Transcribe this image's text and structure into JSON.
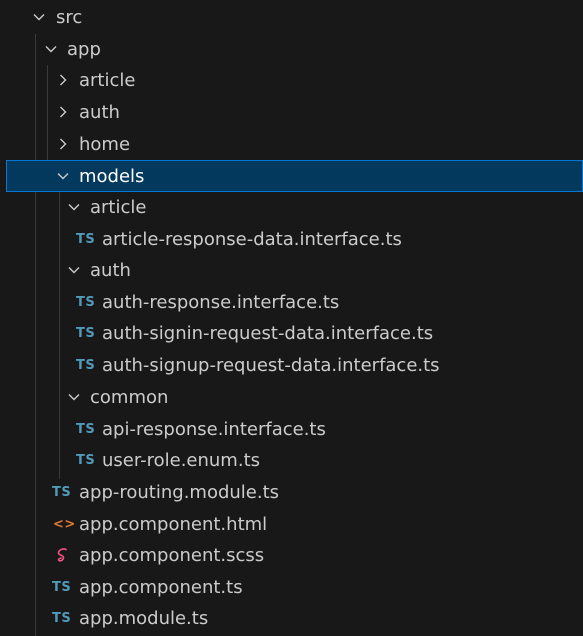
{
  "tree": {
    "src": {
      "label": "src",
      "state": "expanded"
    },
    "app": {
      "label": "app",
      "state": "expanded"
    },
    "article_folder": {
      "label": "article",
      "state": "collapsed"
    },
    "auth_folder": {
      "label": "auth",
      "state": "collapsed"
    },
    "home_folder": {
      "label": "home",
      "state": "collapsed"
    },
    "models_folder": {
      "label": "models",
      "state": "expanded"
    },
    "models_article": {
      "label": "article",
      "state": "expanded"
    },
    "article_response": {
      "label": "article-response-data.interface.ts",
      "icon_text": "TS"
    },
    "models_auth": {
      "label": "auth",
      "state": "expanded"
    },
    "auth_response": {
      "label": "auth-response.interface.ts",
      "icon_text": "TS"
    },
    "auth_signin": {
      "label": "auth-signin-request-data.interface.ts",
      "icon_text": "TS"
    },
    "auth_signup": {
      "label": "auth-signup-request-data.interface.ts",
      "icon_text": "TS"
    },
    "models_common": {
      "label": "common",
      "state": "expanded"
    },
    "api_response": {
      "label": "api-response.interface.ts",
      "icon_text": "TS"
    },
    "user_role": {
      "label": "user-role.enum.ts",
      "icon_text": "TS"
    },
    "app_routing": {
      "label": "app-routing.module.ts",
      "icon_text": "TS"
    },
    "app_component_html": {
      "label": "app.component.html",
      "icon_text": "<>"
    },
    "app_component_scss": {
      "label": "app.component.scss"
    },
    "app_component_ts": {
      "label": "app.component.ts",
      "icon_text": "TS"
    },
    "app_module": {
      "label": "app.module.ts",
      "icon_text": "TS"
    }
  },
  "colors": {
    "background": "#181818",
    "selected_background": "#04395e",
    "selected_border": "#0078d4",
    "text": "#cccccc",
    "ts_icon": "#519aba",
    "html_icon": "#e37933",
    "scss_icon": "#f55385",
    "indent_guide": "#3a3a3a"
  },
  "selected": "models"
}
